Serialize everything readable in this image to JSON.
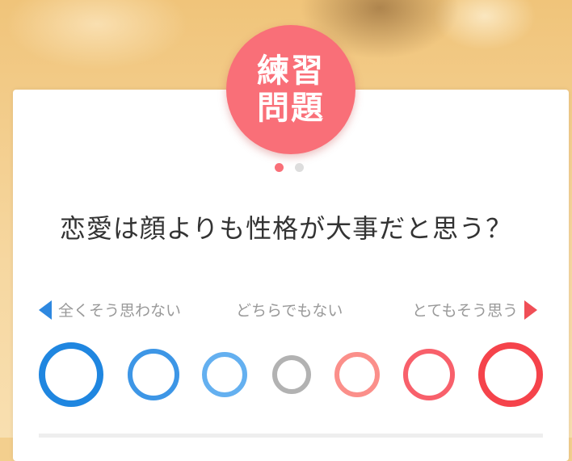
{
  "badge": {
    "line1": "練習",
    "line2": "問題"
  },
  "pagination": {
    "total": 2,
    "current": 1
  },
  "question": {
    "text": "恋愛は顔よりも性格が大事だと思う？"
  },
  "scale": {
    "left_label": "全くそう思わない",
    "middle_label": "どちらでもない",
    "right_label": "とてもそう思う",
    "options_count": 7
  },
  "colors": {
    "accent": "#f96f78",
    "disagree": "#1f86e0",
    "neutral": "#b2b2b2",
    "agree": "#f5434b"
  }
}
